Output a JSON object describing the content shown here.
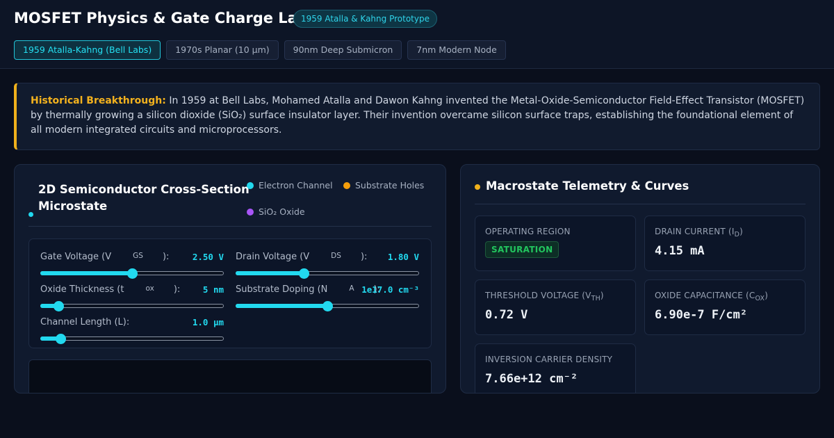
{
  "header": {
    "title": "MOSFET Physics & Gate Charge Lab",
    "badge": "1959 Atalla & Kahng Prototype",
    "tabs": [
      {
        "label": "1959 Atalla-Kahng (Bell Labs)",
        "active": true
      },
      {
        "label": "1970s Planar (10 µm)",
        "active": false
      },
      {
        "label": "90nm Deep Submicron",
        "active": false
      },
      {
        "label": "7nm Modern Node",
        "active": false
      }
    ]
  },
  "callout": {
    "lead": "Historical Breakthrough:",
    "text": "In 1959 at Bell Labs, Mohamed Atalla and Dawon Kahng invented the Metal-Oxide-Semiconductor Field-Effect Transistor (MOSFET) by thermally growing a silicon dioxide (SiO₂) surface insulator layer. Their invention overcame silicon surface traps, establishing the foundational element of all modern integrated circuits and microprocessors."
  },
  "cross_section": {
    "title": "2D Semiconductor Cross-Section Microstate",
    "legend": [
      {
        "label": "Electron Channel",
        "color": "#22d9ef"
      },
      {
        "label": "Substrate Holes",
        "color": "#f59e0b"
      },
      {
        "label": "SiO₂ Oxide",
        "color": "#a855f7"
      }
    ],
    "controls": [
      {
        "label": "Gate Voltage (V",
        "sub": "GS",
        "suffix": "):",
        "value": "2.50 V",
        "fraction": 0.5
      },
      {
        "label": "Drain Voltage (V",
        "sub": "DS",
        "suffix": "):",
        "value": "1.80 V",
        "fraction": 0.37
      },
      {
        "label": "Oxide Thickness (t",
        "sub": "ox",
        "suffix": "):",
        "value": "5 nm",
        "fraction": 0.1
      },
      {
        "label": "Substrate Doping (N",
        "sub": "A",
        "suffix": "):",
        "value": "1e17.0 cm⁻³",
        "fraction": 0.5
      },
      {
        "label": "Channel Length (L):",
        "sub": "",
        "suffix": "",
        "value": "1.0 µm",
        "fraction": 0.11
      }
    ]
  },
  "telemetry": {
    "title": "Macrostate Telemetry & Curves",
    "operating_region_label": "OPERATING REGION",
    "operating_region_value": "SATURATION",
    "drain_current_label": "DRAIN CURRENT (I",
    "drain_current_sub": "D",
    "drain_current_value": "4.15 mA",
    "threshold_label": "THRESHOLD VOLTAGE (V",
    "threshold_sub": "TH",
    "threshold_value": "0.72 V",
    "cox_label": "OXIDE CAPACITANCE (C",
    "cox_sub": "OX",
    "cox_value": "6.90e-7 F/cm²",
    "density_label": "INVERSION CARRIER DENSITY",
    "density_value": "7.66e+12 cm⁻²"
  }
}
